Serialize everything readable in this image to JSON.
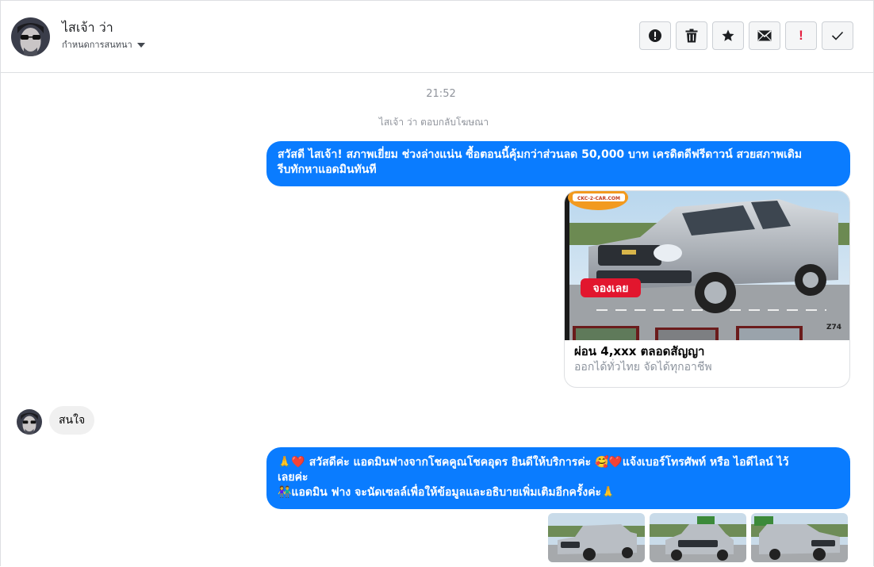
{
  "header": {
    "contact_name": "ไสเจ้า ว่า",
    "assign_label": "กำหนดการสนทนา",
    "actions": [
      {
        "name": "report",
        "icon": "alert-circle-icon"
      },
      {
        "name": "delete",
        "icon": "trash-icon"
      },
      {
        "name": "star",
        "icon": "star-icon"
      },
      {
        "name": "mark-unread",
        "icon": "envelope-icon"
      },
      {
        "name": "important",
        "icon": "exclamation-icon",
        "glyph": "!"
      },
      {
        "name": "done",
        "icon": "check-icon"
      }
    ]
  },
  "conversation": {
    "timestamp": "21:52",
    "notice": "ไสเจ้า ว่า ตอบกลับโฆษณา",
    "messages": [
      {
        "direction": "out",
        "line1": "สวัสดี ไสเจ้า!  สภาพเยี่ยม ช่วงล่างแน่น  ซื้อตอนนี้คุ้มกว่าส่วนลด 50,000 บาท เครดิตดีฟรีดาวน์  สวยสภาพเดิม",
        "line2": "รีบทักหาแอดมินทันที"
      },
      {
        "direction": "out",
        "type": "card",
        "brand_badge": "CKC-2-CAR.COM",
        "sticker": "จองเลย",
        "tag": "Z74",
        "title": "ผ่อน 4,xxx ตลอดสัญญา",
        "subtitle": "ออกได้ทั่วไทย จัดได้ทุกอาชีพ"
      },
      {
        "direction": "in",
        "text": "สนใจ"
      },
      {
        "direction": "out",
        "line1": "🙏❤️ สวัสดีค่ะ แอดมินฟางจากโชคคูณโชคอุดร ยินดีให้บริการค่ะ  🥰❤️แจ้งเบอร์โทรศัพท์ หรือ ไอดีไลน์  ไว้",
        "line2": "เลยค่ะ",
        "line3": "👫แอดมิน ฟาง จะนัดเซลล์เพื่อให้ข้อมูลและอธิบายเพิ่มเติมอีกครั้งค่ะ🙏"
      }
    ],
    "thumbnails": [
      "car-photo-1",
      "car-photo-2",
      "car-photo-3"
    ]
  },
  "colors": {
    "accent": "#0a7cff",
    "incoming_bubble": "#f0f0f0",
    "muted_text": "#90949c",
    "important": "#e41e3f"
  }
}
